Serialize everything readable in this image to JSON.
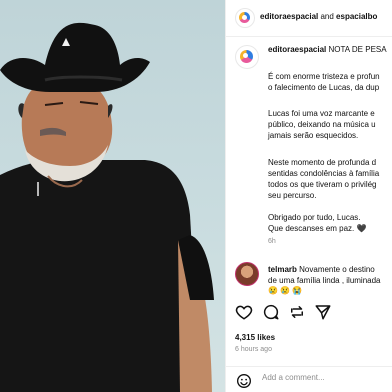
{
  "post": {
    "header": {
      "account": "editoraespacial",
      "joiner": " and ",
      "collab": "espacialbo"
    },
    "caption": {
      "author": "editoraespacial",
      "title": "NOTA DE PESA",
      "lines": [
        "É com enorme tristeza e profun",
        "o falecimento de Lucas, da dup",
        "",
        "Lucas foi uma voz marcante e",
        "público, deixando na música u",
        "jamais serão esquecidos.",
        "",
        "Neste momento de profunda d",
        "sentidas condolências à família",
        "todos os que tiveram o privilég",
        "seu percurso.",
        "",
        "Obrigado por tudo, Lucas.",
        "Que descanses em paz. 🖤"
      ],
      "time": "6h"
    },
    "comment": {
      "author": "telmarb",
      "line1": "Novamente o destino",
      "line2": "de uma família linda , iluminada",
      "emojis": "😢 😢 😭"
    },
    "likes": "4,315 likes",
    "posted_ago": "6 hours ago",
    "add_comment_placeholder": "Add a comment...",
    "icons": [
      "heart-icon",
      "comment-icon",
      "share-icon",
      "send-icon",
      "emoji-icon"
    ]
  }
}
